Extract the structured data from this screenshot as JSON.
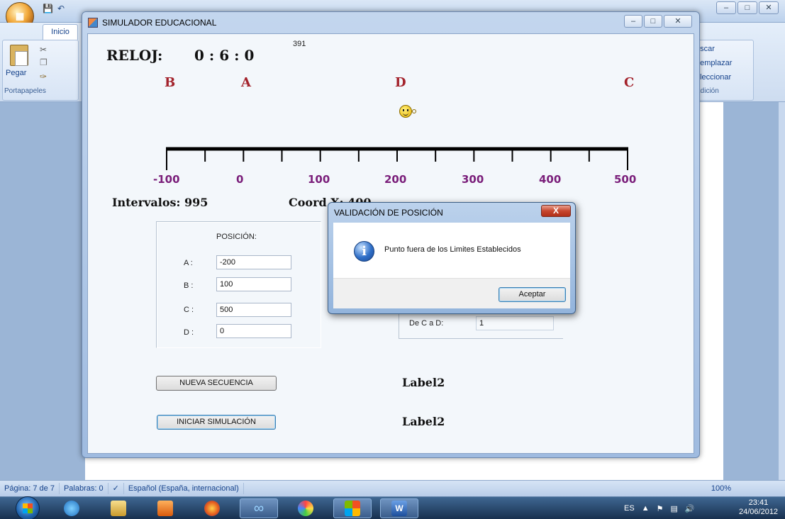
{
  "word": {
    "tab": "Inicio",
    "clipboard": {
      "paste": "Pegar",
      "group": "Portapapeles"
    },
    "editing": {
      "find": "uscar",
      "replace": "eemplazar",
      "select": "eleccionar",
      "group": "Edición"
    },
    "status": {
      "page": "Página: 7 de 7",
      "words": "Palabras: 0",
      "language": "Español (España, internacional)",
      "zoom": "100%"
    }
  },
  "simulator": {
    "title": "SIMULADOR  EDUCACIONAL",
    "clock_label": "RELOJ:",
    "clock_value": "0 : 6 : 0",
    "counter": "391",
    "letters": [
      "B",
      "A",
      "D",
      "C"
    ],
    "ticks": [
      "-100",
      "0",
      "100",
      "200",
      "300",
      "400",
      "500"
    ],
    "intervals": "Intervalos: 995",
    "coord_x": "Coord X: 400",
    "position_panel": {
      "title": "POSICIÓN:",
      "rows": [
        {
          "label": "A :",
          "value": "-200"
        },
        {
          "label": "B :",
          "value": "100"
        },
        {
          "label": "C :",
          "value": "500"
        },
        {
          "label": "D :",
          "value": "0"
        }
      ]
    },
    "distance": {
      "label": "De C a D:",
      "value": "1"
    },
    "btn_new": "NUEVA SECUENCIA",
    "btn_start": "INICIAR SIMULACIÓN",
    "label_a": "Label2",
    "label_b": "Label2"
  },
  "dialog": {
    "title": "VALIDACIÓN DE POSICIÓN",
    "message": "Punto fuera de los Limites Establecidos",
    "ok": "Aceptar",
    "close": "X"
  },
  "taskbar": {
    "lang": "ES",
    "time": "23:41",
    "date": "24/06/2012"
  }
}
